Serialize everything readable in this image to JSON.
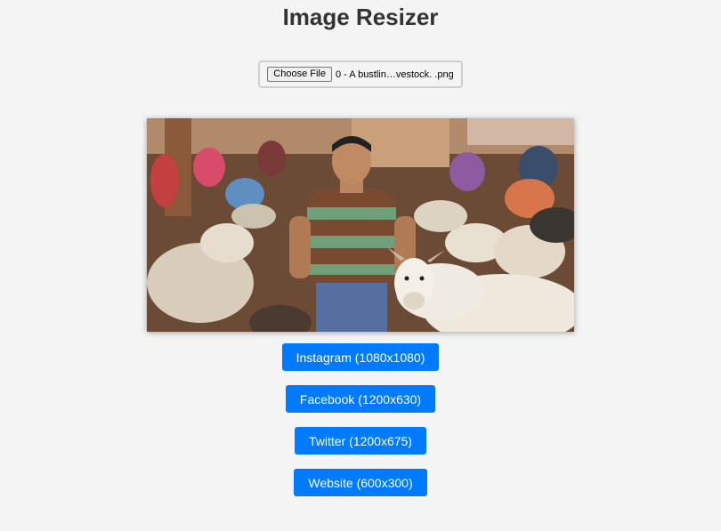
{
  "page": {
    "title": "Image Resizer"
  },
  "file_input": {
    "button_label": "Choose File",
    "file_name": "0 - A bustlin…vestock. .png"
  },
  "buttons": [
    {
      "label": "Instagram (1080x1080)"
    },
    {
      "label": "Facebook (1200x630)"
    },
    {
      "label": "Twitter (1200x675)"
    },
    {
      "label": "Website (600x300)"
    }
  ],
  "colors": {
    "background": "#f4f4f4",
    "accent": "#007bff",
    "title": "#333333"
  }
}
